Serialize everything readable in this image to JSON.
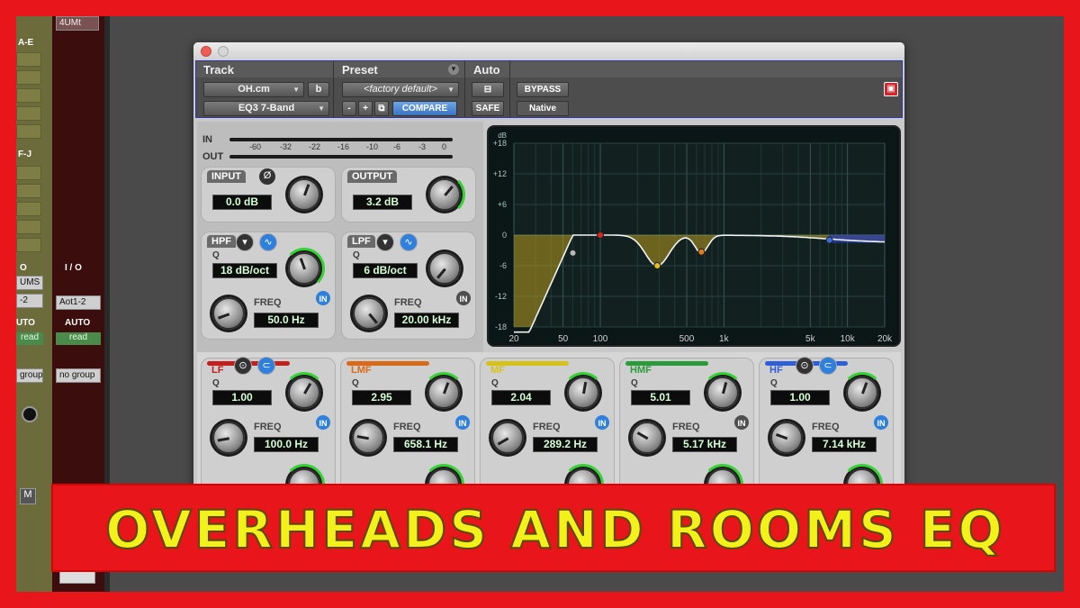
{
  "banner": {
    "title": "OVERHEADS AND ROOMS EQ"
  },
  "mixer": {
    "strip_a": {
      "label_top": "A-E",
      "label_mid": "F-J",
      "io": "O",
      "input": "UMS",
      "input2": "-2",
      "auto": "UTO",
      "mode": "read",
      "group": "group"
    },
    "strip_b": {
      "name": "4UMt",
      "io": "I / O",
      "input": "Aot1-2",
      "auto": "AUTO",
      "mode": "read",
      "group": "no group"
    }
  },
  "plugin": {
    "header": {
      "track_title": "Track",
      "preset_title": "Preset",
      "auto_title": "Auto",
      "track_name": "OH.cm",
      "track_channel": "b",
      "plugin_name": "EQ3 7-Band",
      "preset_value": "<factory default>",
      "minus": "-",
      "plus": "+",
      "compare": "COMPARE",
      "safe": "SAFE",
      "bypass": "BYPASS",
      "native": "Native"
    },
    "meters": {
      "in_label": "IN",
      "out_label": "OUT",
      "scale": [
        "-60",
        "-32",
        "-22",
        "-16",
        "-10",
        "-6",
        "-3",
        "0"
      ]
    },
    "input": {
      "label": "INPUT",
      "value": "0.0 dB",
      "phase": "Ø"
    },
    "output": {
      "label": "OUTPUT",
      "value": "3.2 dB"
    },
    "hpf": {
      "label": "HPF",
      "q_label": "Q",
      "q_value": "18 dB/oct",
      "freq_label": "FREQ",
      "freq_value": "50.0 Hz",
      "in": "IN"
    },
    "lpf": {
      "label": "LPF",
      "q_label": "Q",
      "q_value": "6 dB/oct",
      "freq_label": "FREQ",
      "freq_value": "20.00 kHz",
      "in": "IN"
    },
    "bands": [
      {
        "label": "LF",
        "q_label": "Q",
        "q_value": "1.00",
        "freq_label": "FREQ",
        "freq_value": "100.0 Hz",
        "in": "IN",
        "color": "#c21f1f"
      },
      {
        "label": "LMF",
        "q_label": "Q",
        "q_value": "2.95",
        "freq_label": "FREQ",
        "freq_value": "658.1 Hz",
        "in": "IN",
        "color": "#d96a1a"
      },
      {
        "label": "MF",
        "q_label": "Q",
        "q_value": "2.04",
        "freq_label": "FREQ",
        "freq_value": "289.2 Hz",
        "in": "IN",
        "color": "#d6c21a"
      },
      {
        "label": "HMF",
        "q_label": "Q",
        "q_value": "5.01",
        "freq_label": "FREQ",
        "freq_value": "5.17 kHz",
        "in": "IN",
        "color": "#2a9a3a"
      },
      {
        "label": "HF",
        "q_label": "Q",
        "q_value": "1.00",
        "freq_label": "FREQ",
        "freq_value": "7.14 kHz",
        "in": "IN",
        "color": "#2f5fd6"
      }
    ],
    "graph": {
      "db_unit": "dB",
      "y_labels": [
        "+18",
        "+12",
        "+6",
        "0",
        "-6",
        "-12",
        "-18"
      ],
      "x_labels": [
        "20",
        "50",
        "100",
        "500",
        "1k",
        "5k",
        "10k",
        "20k"
      ]
    }
  }
}
